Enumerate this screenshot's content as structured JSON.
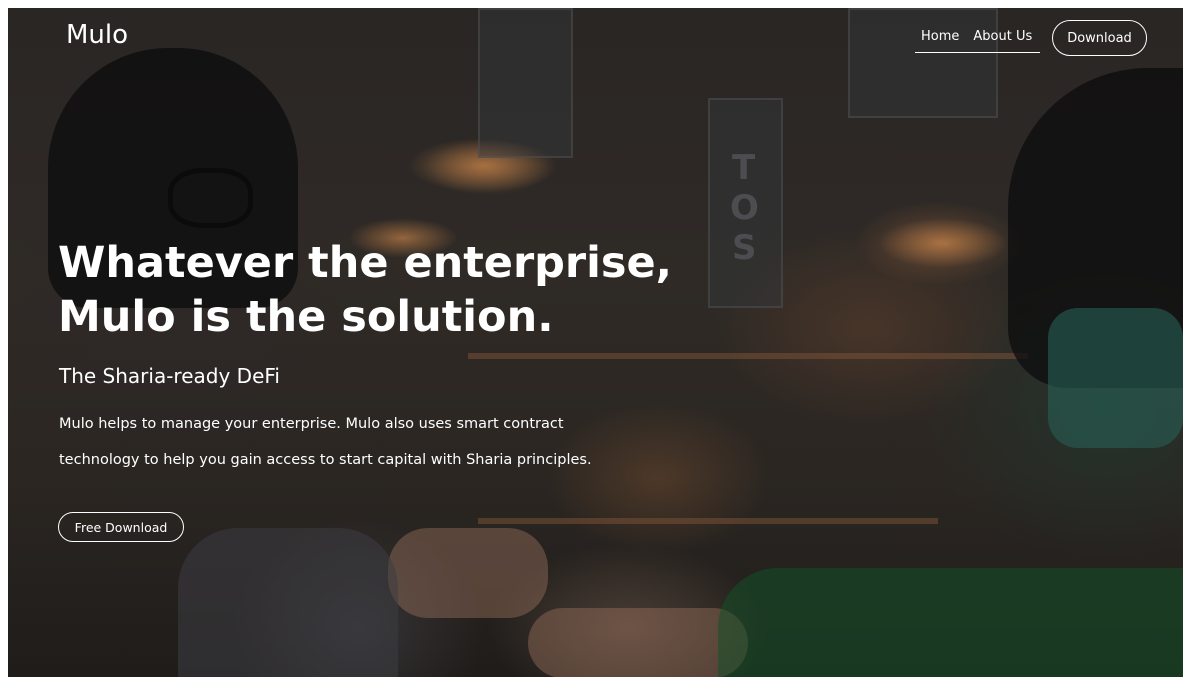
{
  "brand": {
    "logo_text": "Mulo"
  },
  "nav": {
    "items": [
      {
        "label": "Home"
      },
      {
        "label": "About Us"
      }
    ],
    "download_label": "Download"
  },
  "hero": {
    "title_line1": "Whatever the enterprise,",
    "title_line2": "Mulo is the solution.",
    "subtitle": "The Sharia-ready DeFi",
    "body_line1": "Mulo helps to manage your enterprise. Mulo also uses smart contract",
    "body_line2": "technology to help you gain access to start capital with Sharia principles.",
    "cta_label": "Free Download"
  },
  "colors": {
    "text": "#ffffff",
    "overlay": "#2a2624"
  }
}
